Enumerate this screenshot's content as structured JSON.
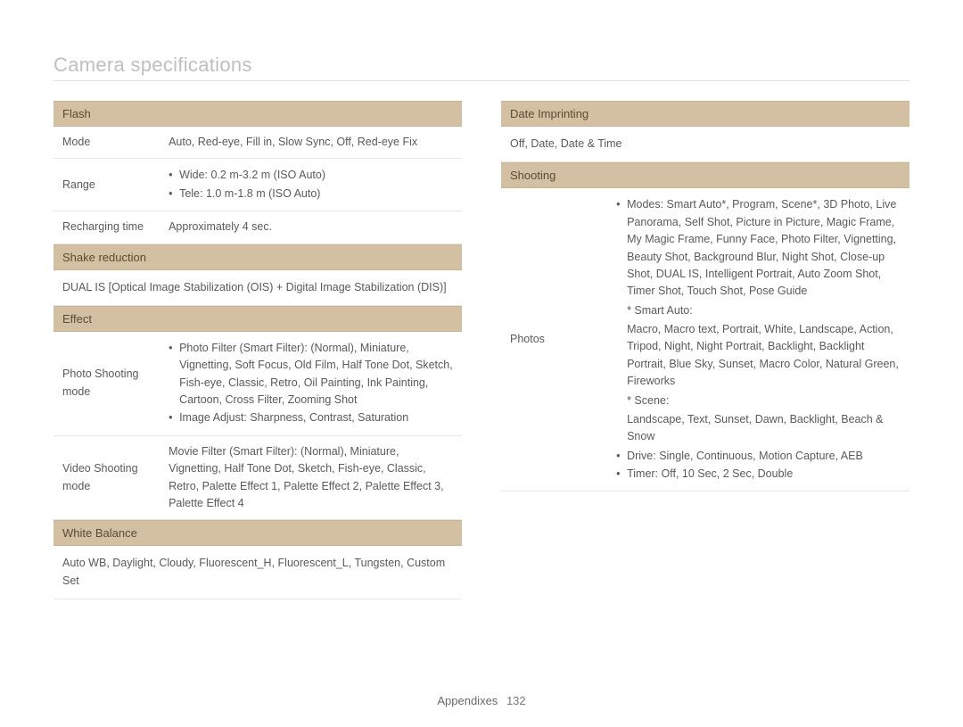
{
  "page_title": "Camera specifications",
  "footer": {
    "section": "Appendixes",
    "page": "132"
  },
  "left": {
    "flash": {
      "header": "Flash",
      "mode_label": "Mode",
      "mode_value": "Auto, Red-eye, Fill in, Slow Sync, Off, Red-eye Fix",
      "range_label": "Range",
      "range_bullets": [
        "Wide: 0.2 m-3.2 m (ISO Auto)",
        "Tele: 1.0 m-1.8 m (ISO Auto)"
      ],
      "recharge_label": "Recharging time",
      "recharge_value": "Approximately 4 sec."
    },
    "shake": {
      "header": "Shake reduction",
      "value": "DUAL IS [Optical Image Stabilization (OIS) + Digital Image Stabilization (DIS)]"
    },
    "effect": {
      "header": "Effect",
      "photo_label": "Photo Shooting mode",
      "photo_bullets": [
        "Photo Filter (Smart Filter): (Normal), Miniature, Vignetting, Soft Focus, Old Film, Half Tone Dot, Sketch, Fish-eye, Classic, Retro, Oil Painting, Ink Painting, Cartoon, Cross Filter, Zooming Shot",
        "Image Adjust: Sharpness, Contrast, Saturation"
      ],
      "video_label": "Video Shooting mode",
      "video_value": "Movie Filter (Smart Filter): (Normal), Miniature, Vignetting, Half Tone Dot, Sketch, Fish-eye, Classic, Retro, Palette Effect 1, Palette Effect 2, Palette Effect 3, Palette Effect 4"
    },
    "white_balance": {
      "header": "White Balance",
      "value": "Auto WB, Daylight, Cloudy, Fluorescent_H, Fluorescent_L, Tungsten, Custom Set"
    }
  },
  "right": {
    "date_imprinting": {
      "header": "Date Imprinting",
      "value": "Off, Date, Date & Time"
    },
    "shooting": {
      "header": "Shooting",
      "photos_label": "Photos",
      "modes_bullet": "Modes: Smart Auto*, Program, Scene*, 3D Photo, Live Panorama, Self Shot, Picture in Picture, Magic Frame, My Magic Frame, Funny Face, Photo Filter, Vignetting, Beauty Shot, Background Blur, Night Shot, Close-up Shot, DUAL IS, Intelligent Portrait, Auto Zoom Shot, Timer Shot, Touch Shot, Pose Guide",
      "smart_auto_label": "* Smart Auto:",
      "smart_auto_value": "Macro, Macro text, Portrait, White, Landscape, Action, Tripod, Night, Night Portrait, Backlight, Backlight Portrait, Blue Sky, Sunset, Macro Color, Natural Green, Fireworks",
      "scene_label": "* Scene:",
      "scene_value": "Landscape, Text, Sunset, Dawn, Backlight, Beach & Snow",
      "drive_bullet": "Drive: Single, Continuous, Motion Capture, AEB",
      "timer_bullet": "Timer: Off, 10 Sec, 2 Sec, Double"
    }
  }
}
